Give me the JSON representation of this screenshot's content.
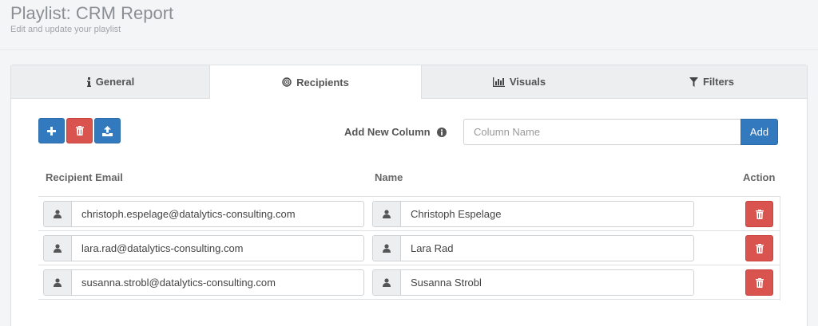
{
  "page": {
    "title": "Playlist: CRM Report",
    "subtitle": "Edit and update your playlist"
  },
  "tabs": [
    {
      "label": "General",
      "icon": "info-icon"
    },
    {
      "label": "Recipients",
      "icon": "target-icon"
    },
    {
      "label": "Visuals",
      "icon": "bar-chart-icon"
    },
    {
      "label": "Filters",
      "icon": "filter-icon"
    }
  ],
  "toolbar": {
    "add_column_label": "Add New Column",
    "column_name_placeholder": "Column Name",
    "add_button_label": "Add"
  },
  "table": {
    "headers": {
      "email": "Recipient Email",
      "name": "Name",
      "action": "Action"
    },
    "rows": [
      {
        "email": "christoph.espelage@datalytics-consulting.com",
        "name": "Christoph Espelage"
      },
      {
        "email": "lara.rad@datalytics-consulting.com",
        "name": "Lara Rad"
      },
      {
        "email": "susanna.strobl@datalytics-consulting.com",
        "name": "Susanna Strobl"
      }
    ]
  },
  "colors": {
    "primary": "#3379be",
    "danger": "#d9534f",
    "tab_inactive": "#eceeef"
  }
}
